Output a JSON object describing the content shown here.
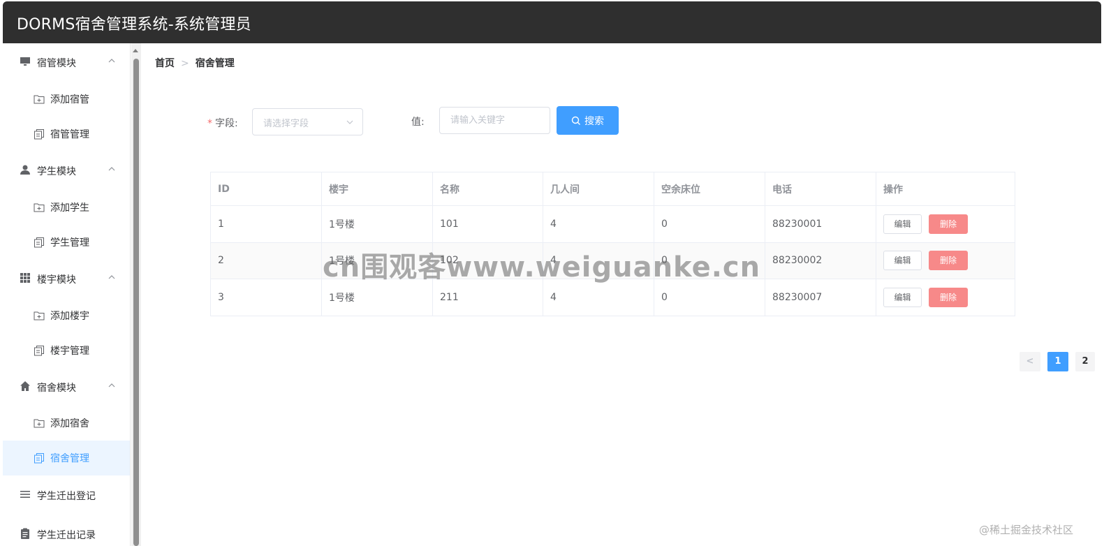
{
  "app": {
    "title": "DORMS宿舍管理系统-系统管理员"
  },
  "sidebar": {
    "groups": [
      {
        "label": "宿管模块",
        "icon": "monitor-icon",
        "items": [
          {
            "label": "添加宿管",
            "icon": "folder-add-icon"
          },
          {
            "label": "宿管管理",
            "icon": "document-copy-icon"
          }
        ]
      },
      {
        "label": "学生模块",
        "icon": "user-icon",
        "items": [
          {
            "label": "添加学生",
            "icon": "folder-add-icon"
          },
          {
            "label": "学生管理",
            "icon": "document-copy-icon"
          }
        ]
      },
      {
        "label": "楼宇模块",
        "icon": "grid-icon",
        "items": [
          {
            "label": "添加楼宇",
            "icon": "folder-add-icon"
          },
          {
            "label": "楼宇管理",
            "icon": "document-copy-icon"
          }
        ]
      },
      {
        "label": "宿舍模块",
        "icon": "house-icon",
        "items": [
          {
            "label": "添加宿舍",
            "icon": "folder-add-icon"
          },
          {
            "label": "宿舍管理",
            "icon": "document-copy-icon",
            "active": true
          }
        ]
      }
    ],
    "standalone": [
      {
        "label": "学生迁出登记",
        "icon": "list-icon"
      },
      {
        "label": "学生迁出记录",
        "icon": "clipboard-icon"
      }
    ]
  },
  "breadcrumb": {
    "home": "首页",
    "separator": ">",
    "current": "宿舍管理"
  },
  "search": {
    "required_mark": "*",
    "field_label": "字段:",
    "field_placeholder": "请选择字段",
    "value_label": "值:",
    "value_placeholder": "请输入关键字",
    "button_label": "搜索"
  },
  "table": {
    "columns": [
      "ID",
      "楼宇",
      "名称",
      "几人间",
      "空余床位",
      "电话",
      "操作"
    ],
    "rows": [
      [
        "1",
        "1号楼",
        "101",
        "4",
        "0",
        "88230001"
      ],
      [
        "2",
        "1号楼",
        "102",
        "4",
        "0",
        "88230002"
      ],
      [
        "3",
        "1号楼",
        "211",
        "4",
        "0",
        "88230007"
      ]
    ],
    "edit_label": "编辑",
    "delete_label": "删除"
  },
  "pagination": {
    "prev": "<",
    "pages": [
      "1",
      "2"
    ],
    "current": "1"
  },
  "watermarks": {
    "center": "cn围观客www.weiguanke.cn",
    "corner": "@稀土掘金技术社区"
  },
  "colors": {
    "topbar": "#2f2f2f",
    "primary": "#409eff",
    "danger": "#f78989",
    "active_bg": "#ecf5ff"
  }
}
